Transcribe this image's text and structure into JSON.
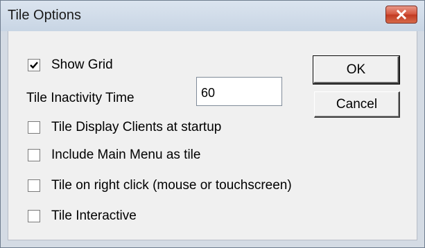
{
  "window": {
    "title": "Tile Options",
    "close_label": "close"
  },
  "options": {
    "show_grid": {
      "label": "Show Grid",
      "checked": true
    },
    "tile_display_clients": {
      "label": "Tile Display Clients at startup",
      "checked": false
    },
    "include_main_menu": {
      "label": "Include Main Menu as tile",
      "checked": false
    },
    "tile_on_right_click": {
      "label": "Tile on right click (mouse or touchscreen)",
      "checked": false
    },
    "tile_interactive": {
      "label": "Tile Interactive",
      "checked": false
    }
  },
  "inactivity": {
    "label": "Tile Inactivity Time",
    "value": "60"
  },
  "buttons": {
    "ok": "OK",
    "cancel": "Cancel"
  },
  "colors": {
    "close_button": "#c94a34",
    "frame": "#d4dbe4",
    "client_bg": "#f0f0f0"
  }
}
